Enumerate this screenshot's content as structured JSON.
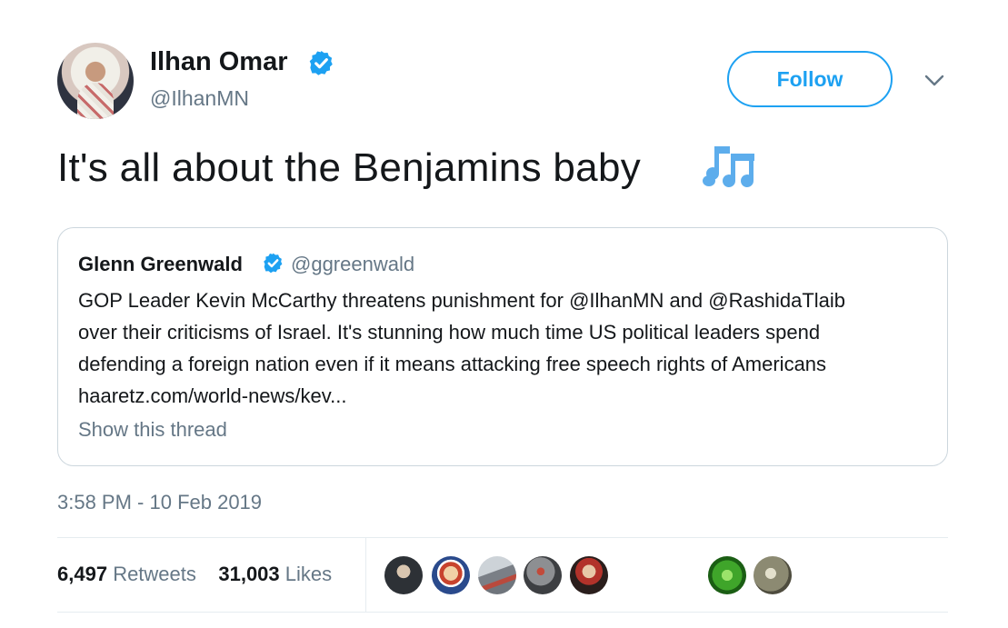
{
  "author": {
    "name": "Ilhan Omar",
    "handle": "@IlhanMN",
    "verified": true
  },
  "follow_button": {
    "label": "Follow"
  },
  "menu": {
    "icon": "chevron-down-icon"
  },
  "tweet": {
    "text": "It's all about the Benjamins baby",
    "emoji": "musical-notes-icon"
  },
  "quoted_tweet": {
    "name": "Glenn Greenwald",
    "handle": "@ggreenwald",
    "verified": true,
    "lines": [
      "GOP Leader Kevin McCarthy threatens punishment for @IlhanMN and @RashidaTlaib",
      "over their criticisms of Israel. It's stunning how much time US political leaders spend",
      "defending a foreign nation even if it means attacking free speech rights of Americans",
      "haaretz.com/world-news/kev..."
    ],
    "show_thread": "Show this thread"
  },
  "timestamp": "3:58 PM - 10 Feb 2019",
  "stats": {
    "retweets_count": "6,497",
    "retweets_label": "Retweets",
    "likes_count": "31,003",
    "likes_label": "Likes"
  },
  "colors": {
    "accent": "#1da1f2",
    "secondary_text": "#657786",
    "border": "#ccd6dd"
  },
  "liker_avatars": [
    {
      "name": "liker-avatar-1",
      "color": "#3a3f45"
    },
    {
      "name": "liker-avatar-2",
      "color": "#c8432e"
    },
    {
      "name": "liker-avatar-3",
      "color": "#7a7f86"
    },
    {
      "name": "liker-avatar-4",
      "color": "#8d8f92"
    },
    {
      "name": "liker-avatar-5",
      "color": "#6b2a24"
    },
    {
      "name": "liker-avatar-6",
      "color": "#3fa52a"
    },
    {
      "name": "liker-avatar-7",
      "color": "#8c8a72"
    }
  ]
}
